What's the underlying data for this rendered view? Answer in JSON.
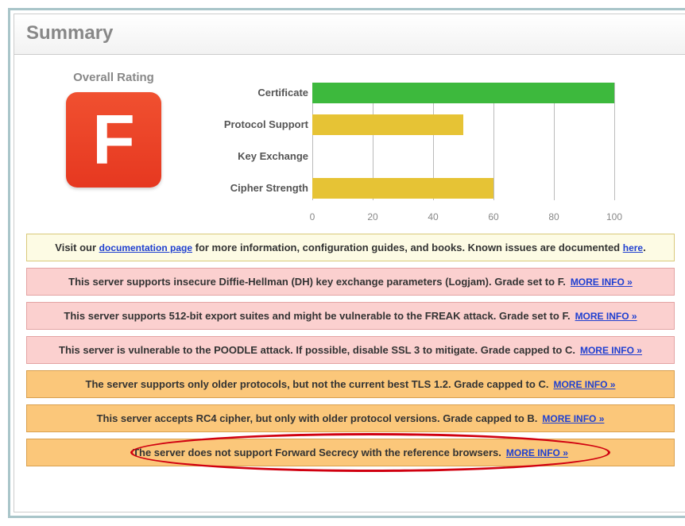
{
  "title": "Summary",
  "rating": {
    "label": "Overall Rating",
    "grade": "F"
  },
  "chart_data": {
    "type": "bar",
    "categories": [
      "Certificate",
      "Protocol Support",
      "Key Exchange",
      "Cipher Strength"
    ],
    "values": [
      100,
      50,
      0,
      60
    ],
    "colors": [
      "green",
      "yellow",
      "yellow",
      "yellow"
    ],
    "xlim": [
      0,
      100
    ],
    "ticks": [
      0,
      20,
      40,
      60,
      80,
      100
    ],
    "title": "",
    "xlabel": "",
    "ylabel": ""
  },
  "notices": [
    {
      "style": "yellow-light",
      "parts": [
        {
          "t": "text",
          "v": "Visit our "
        },
        {
          "t": "link",
          "v": "documentation page"
        },
        {
          "t": "text",
          "v": " for more information, configuration guides, and books. Known issues are documented "
        },
        {
          "t": "link",
          "v": "here"
        },
        {
          "t": "text",
          "v": "."
        }
      ]
    },
    {
      "style": "pink",
      "text": "This server supports insecure Diffie-Hellman (DH) key exchange parameters (Logjam). Grade set to F.",
      "more_info": "MORE INFO »"
    },
    {
      "style": "pink",
      "text": "This server supports 512-bit export suites and might be vulnerable to the FREAK attack. Grade set to F.",
      "more_info": "MORE INFO »"
    },
    {
      "style": "pink",
      "text": "This server is vulnerable to the POODLE attack. If possible, disable SSL 3 to mitigate. Grade capped to C.",
      "more_info": "MORE INFO »"
    },
    {
      "style": "orange",
      "text": "The server supports only older protocols, but not the current best TLS 1.2. Grade capped to C.",
      "more_info": "MORE INFO »"
    },
    {
      "style": "orange",
      "text": "This server accepts RC4 cipher, but only with older protocol versions. Grade capped to B.",
      "more_info": "MORE INFO »"
    },
    {
      "style": "orange",
      "text": "The server does not support Forward Secrecy with the reference browsers.",
      "more_info": "MORE INFO »",
      "highlighted": true
    }
  ]
}
